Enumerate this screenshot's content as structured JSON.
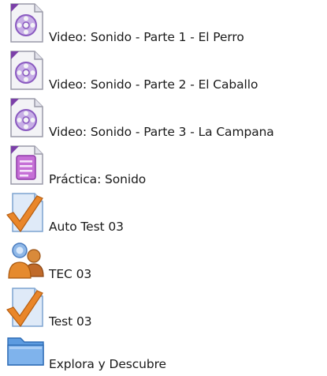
{
  "activities": [
    {
      "label": "Video: Sonido - Parte 1 - El Perro",
      "icon": "video-resource-icon"
    },
    {
      "label": "Video: Sonido - Parte 2 - El Caballo",
      "icon": "video-resource-icon"
    },
    {
      "label": "Video: Sonido - Parte 3 - La Campana",
      "icon": "video-resource-icon"
    },
    {
      "label": "Práctica: Sonido",
      "icon": "practice-document-icon"
    },
    {
      "label": "Auto Test 03",
      "icon": "quiz-check-icon"
    },
    {
      "label": "TEC 03",
      "icon": "users-group-icon"
    },
    {
      "label": "Test 03",
      "icon": "quiz-check-icon"
    },
    {
      "label": "Explora y Descubre",
      "icon": "folder-icon"
    }
  ],
  "colors": {
    "video_purple": "#a37bd0",
    "doc_purple": "#9b4fb0",
    "check_orange": "#e07b1a",
    "folder_blue": "#4f8ed6"
  }
}
